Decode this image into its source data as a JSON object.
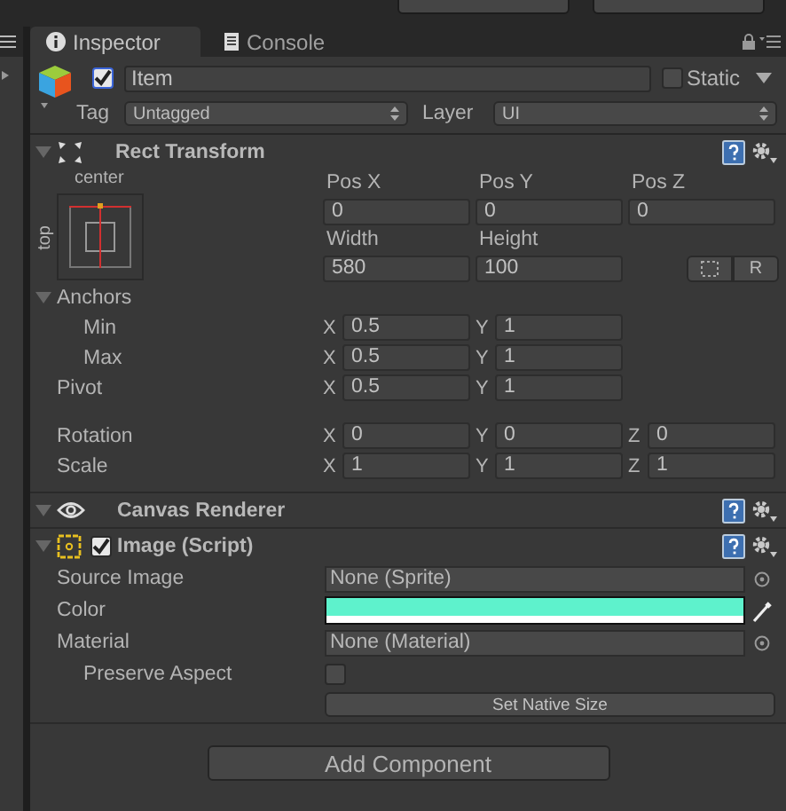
{
  "tabs": [
    {
      "label": "Inspector",
      "kind": "info",
      "selected": true
    },
    {
      "label": "Console",
      "kind": "console",
      "selected": false
    }
  ],
  "object": {
    "active": true,
    "name": "Item",
    "static": false,
    "static_label": "Static",
    "tag_label": "Tag",
    "tag": "Untagged",
    "layer_label": "Layer",
    "layer": "UI"
  },
  "rect_transform": {
    "title": "Rect Transform",
    "expanded": true,
    "anchor_preset": {
      "horizontal": "center",
      "vertical": "top"
    },
    "position_fields": [
      {
        "label": "Pos X",
        "value": "0"
      },
      {
        "label": "Pos Y",
        "value": "0"
      },
      {
        "label": "Pos Z",
        "value": "0"
      }
    ],
    "size_fields": [
      {
        "label": "Width",
        "value": "580"
      },
      {
        "label": "Height",
        "value": "100"
      }
    ],
    "raw_button": "R",
    "anchor_rows": [
      {
        "label": "Anchors",
        "expanded": true,
        "children": [
          {
            "label": "Min",
            "fields": [
              {
                "axis": "X",
                "value": "0.5"
              },
              {
                "axis": "Y",
                "value": "1"
              }
            ]
          },
          {
            "label": "Max",
            "fields": [
              {
                "axis": "X",
                "value": "0.5"
              },
              {
                "axis": "Y",
                "value": "1"
              }
            ]
          }
        ]
      },
      {
        "label": "Pivot",
        "fields": [
          {
            "axis": "X",
            "value": "0.5"
          },
          {
            "axis": "Y",
            "value": "1"
          }
        ]
      }
    ],
    "transform_rows": [
      {
        "label": "Rotation",
        "fields": [
          {
            "axis": "X",
            "value": "0"
          },
          {
            "axis": "Y",
            "value": "0"
          },
          {
            "axis": "Z",
            "value": "0"
          }
        ]
      },
      {
        "label": "Scale",
        "fields": [
          {
            "axis": "X",
            "value": "1"
          },
          {
            "axis": "Y",
            "value": "1"
          },
          {
            "axis": "Z",
            "value": "1"
          }
        ]
      }
    ]
  },
  "canvas_renderer": {
    "title": "Canvas Renderer",
    "expanded": true
  },
  "image": {
    "title": "Image (Script)",
    "enabled": true,
    "expanded": true,
    "fields": [
      {
        "kind": "object",
        "label": "Source Image",
        "value": "None (Sprite)"
      },
      {
        "kind": "color",
        "label": "Color",
        "color": "#5ef2cc",
        "level": 1
      },
      {
        "kind": "object",
        "label": "Material",
        "value": "None (Material)"
      },
      {
        "kind": "checkbox",
        "label": "Preserve Aspect",
        "checked": false
      }
    ],
    "button": "Set Native Size"
  },
  "add_component": "Add Component"
}
